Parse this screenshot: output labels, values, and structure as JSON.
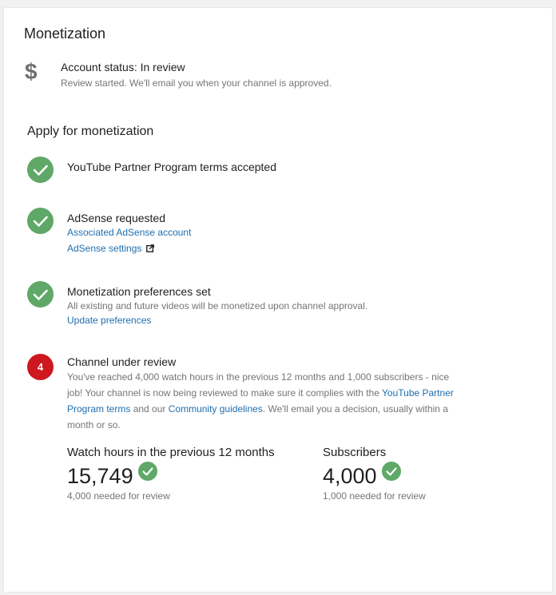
{
  "page": {
    "title": "Monetization"
  },
  "account_status": {
    "icon": "dollar-icon",
    "title": "Account status: In review",
    "subtitle": "Review started. We'll email you when your channel is approved."
  },
  "apply": {
    "title": "Apply for monetization",
    "steps": [
      {
        "status": "done",
        "icon": "check-icon",
        "title": "YouTube Partner Program terms accepted"
      },
      {
        "status": "done",
        "icon": "check-icon",
        "title": "AdSense requested",
        "links": [
          "Associated AdSense account",
          "AdSense settings"
        ]
      },
      {
        "status": "done",
        "icon": "check-icon",
        "title": "Monetization preferences set",
        "description": "All existing and future videos will be monetized upon channel approval.",
        "links": [
          "Update preferences"
        ]
      },
      {
        "status": "in-progress",
        "number": "4",
        "title": "Channel under review",
        "description_parts": {
          "p1": "You've reached 4,000 watch hours in the previous 12 months and 1,000 subscribers - nice job! Your channel is now being reviewed to make sure it complies with the ",
          "link1": "YouTube Partner Program terms",
          "p2": " and our ",
          "link2": "Community guidelines",
          "p3": ". We'll email you a decision, usually within a month or so."
        },
        "metrics": [
          {
            "label": "Watch hours in the previous 12 months",
            "value": "15,749",
            "note": "4,000 needed for review"
          },
          {
            "label": "Subscribers",
            "value": "4,000",
            "note": "1,000 needed for review"
          }
        ]
      }
    ]
  },
  "colors": {
    "success": "#5fa867",
    "alert": "#cc181e",
    "link": "#1f6eaf",
    "muted_text": "#757575"
  }
}
